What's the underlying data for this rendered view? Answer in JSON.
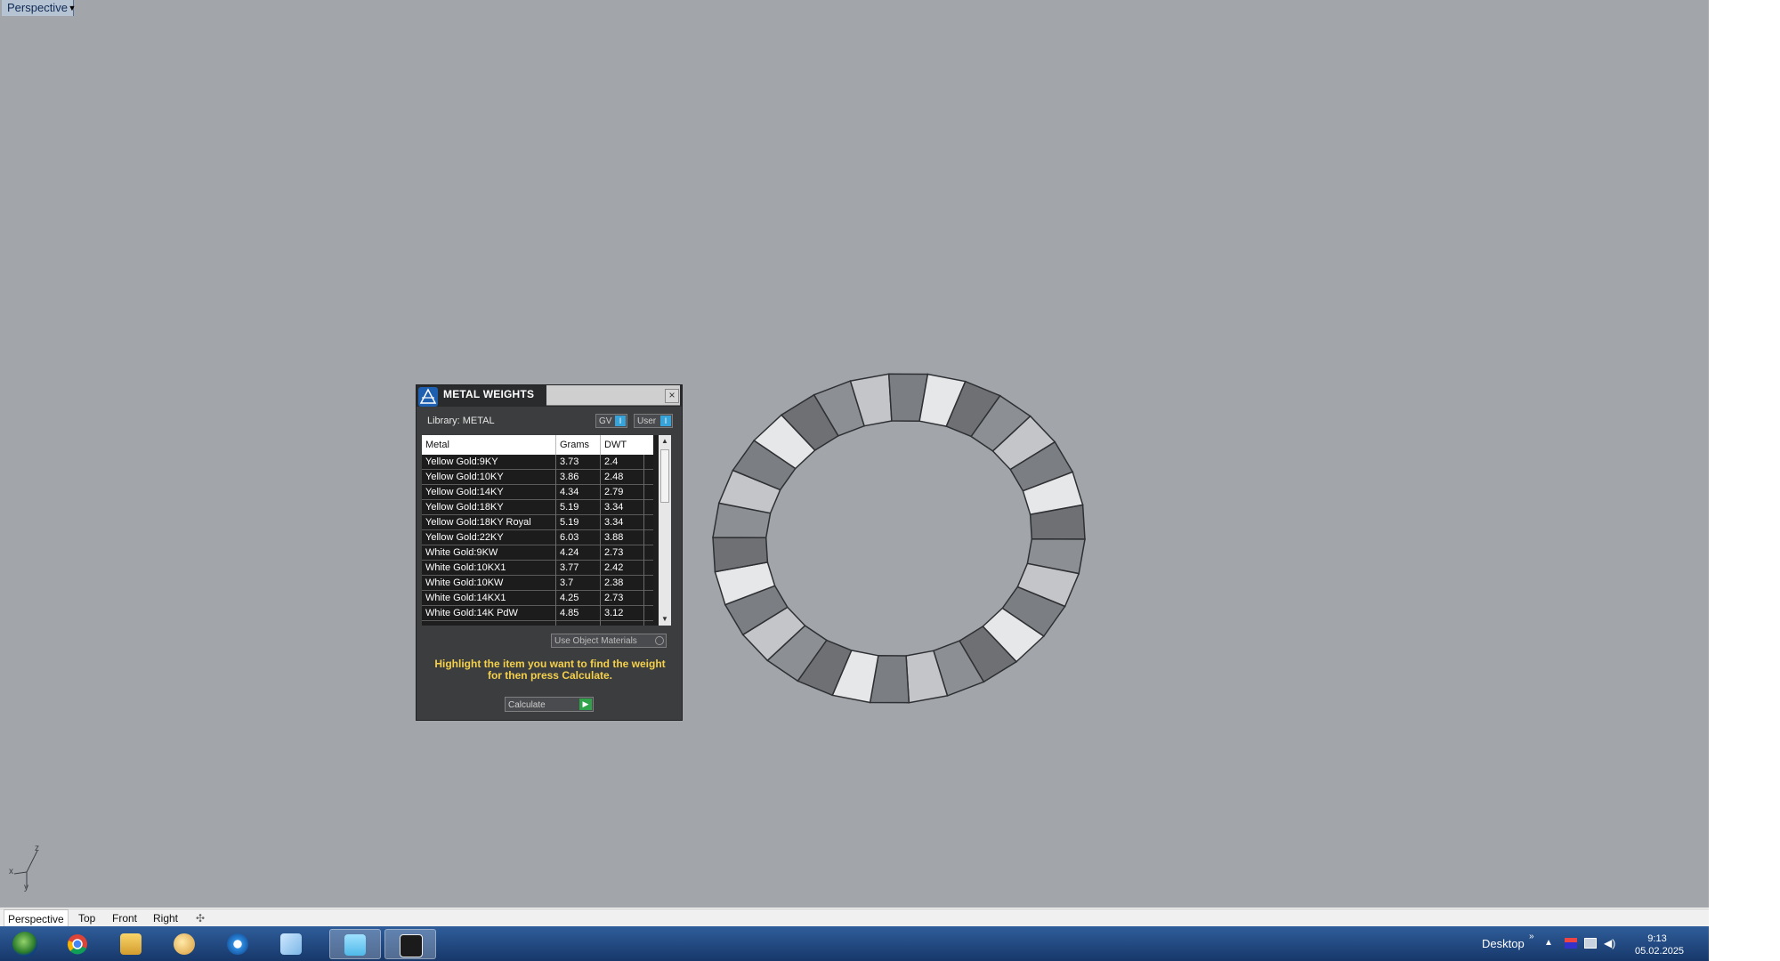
{
  "viewport": {
    "title": "Perspective",
    "background": "#a2a6ab",
    "axis": {
      "z": "z",
      "x": "x",
      "y": "y"
    }
  },
  "metal_panel": {
    "title": "METAL WEIGHTS",
    "library_label": "Library: METAL",
    "toggle_gv": "GV",
    "toggle_user": "User",
    "columns": [
      "Metal",
      "Grams",
      "DWT"
    ],
    "rows": [
      {
        "metal": "Yellow Gold:9KY",
        "grams": "3.73",
        "dwt": "2.4"
      },
      {
        "metal": "Yellow Gold:10KY",
        "grams": "3.86",
        "dwt": "2.48"
      },
      {
        "metal": "Yellow Gold:14KY",
        "grams": "4.34",
        "dwt": "2.79"
      },
      {
        "metal": "Yellow Gold:18KY",
        "grams": "5.19",
        "dwt": "3.34"
      },
      {
        "metal": "Yellow Gold:18KY Royal",
        "grams": "5.19",
        "dwt": "3.34"
      },
      {
        "metal": "Yellow Gold:22KY",
        "grams": "6.03",
        "dwt": "3.88"
      },
      {
        "metal": "White Gold:9KW",
        "grams": "4.24",
        "dwt": "2.73"
      },
      {
        "metal": "White Gold:10KX1",
        "grams": "3.77",
        "dwt": "2.42"
      },
      {
        "metal": "White Gold:10KW",
        "grams": "3.7",
        "dwt": "2.38"
      },
      {
        "metal": "White Gold:14KX1",
        "grams": "4.25",
        "dwt": "2.73"
      },
      {
        "metal": "White Gold:14K PdW",
        "grams": "4.85",
        "dwt": "3.12"
      }
    ],
    "use_object_materials": "Use Object Materials",
    "instruction": "Highlight the item you want to find the weight for then press Calculate.",
    "calculate_label": "Calculate",
    "accent_yellow": "#f4d04b"
  },
  "viewport_tabs": [
    "Perspective",
    "Top",
    "Front",
    "Right"
  ],
  "taskbar": {
    "apps": [
      "start-orb",
      "chrome-icon",
      "file-explorer-icon",
      "paint-icon",
      "app-blue-icon",
      "document-icon",
      "vray-icon",
      "rhino-icon"
    ],
    "desktop_label": "Desktop",
    "time": "9:13",
    "date": "05.02.2025"
  }
}
